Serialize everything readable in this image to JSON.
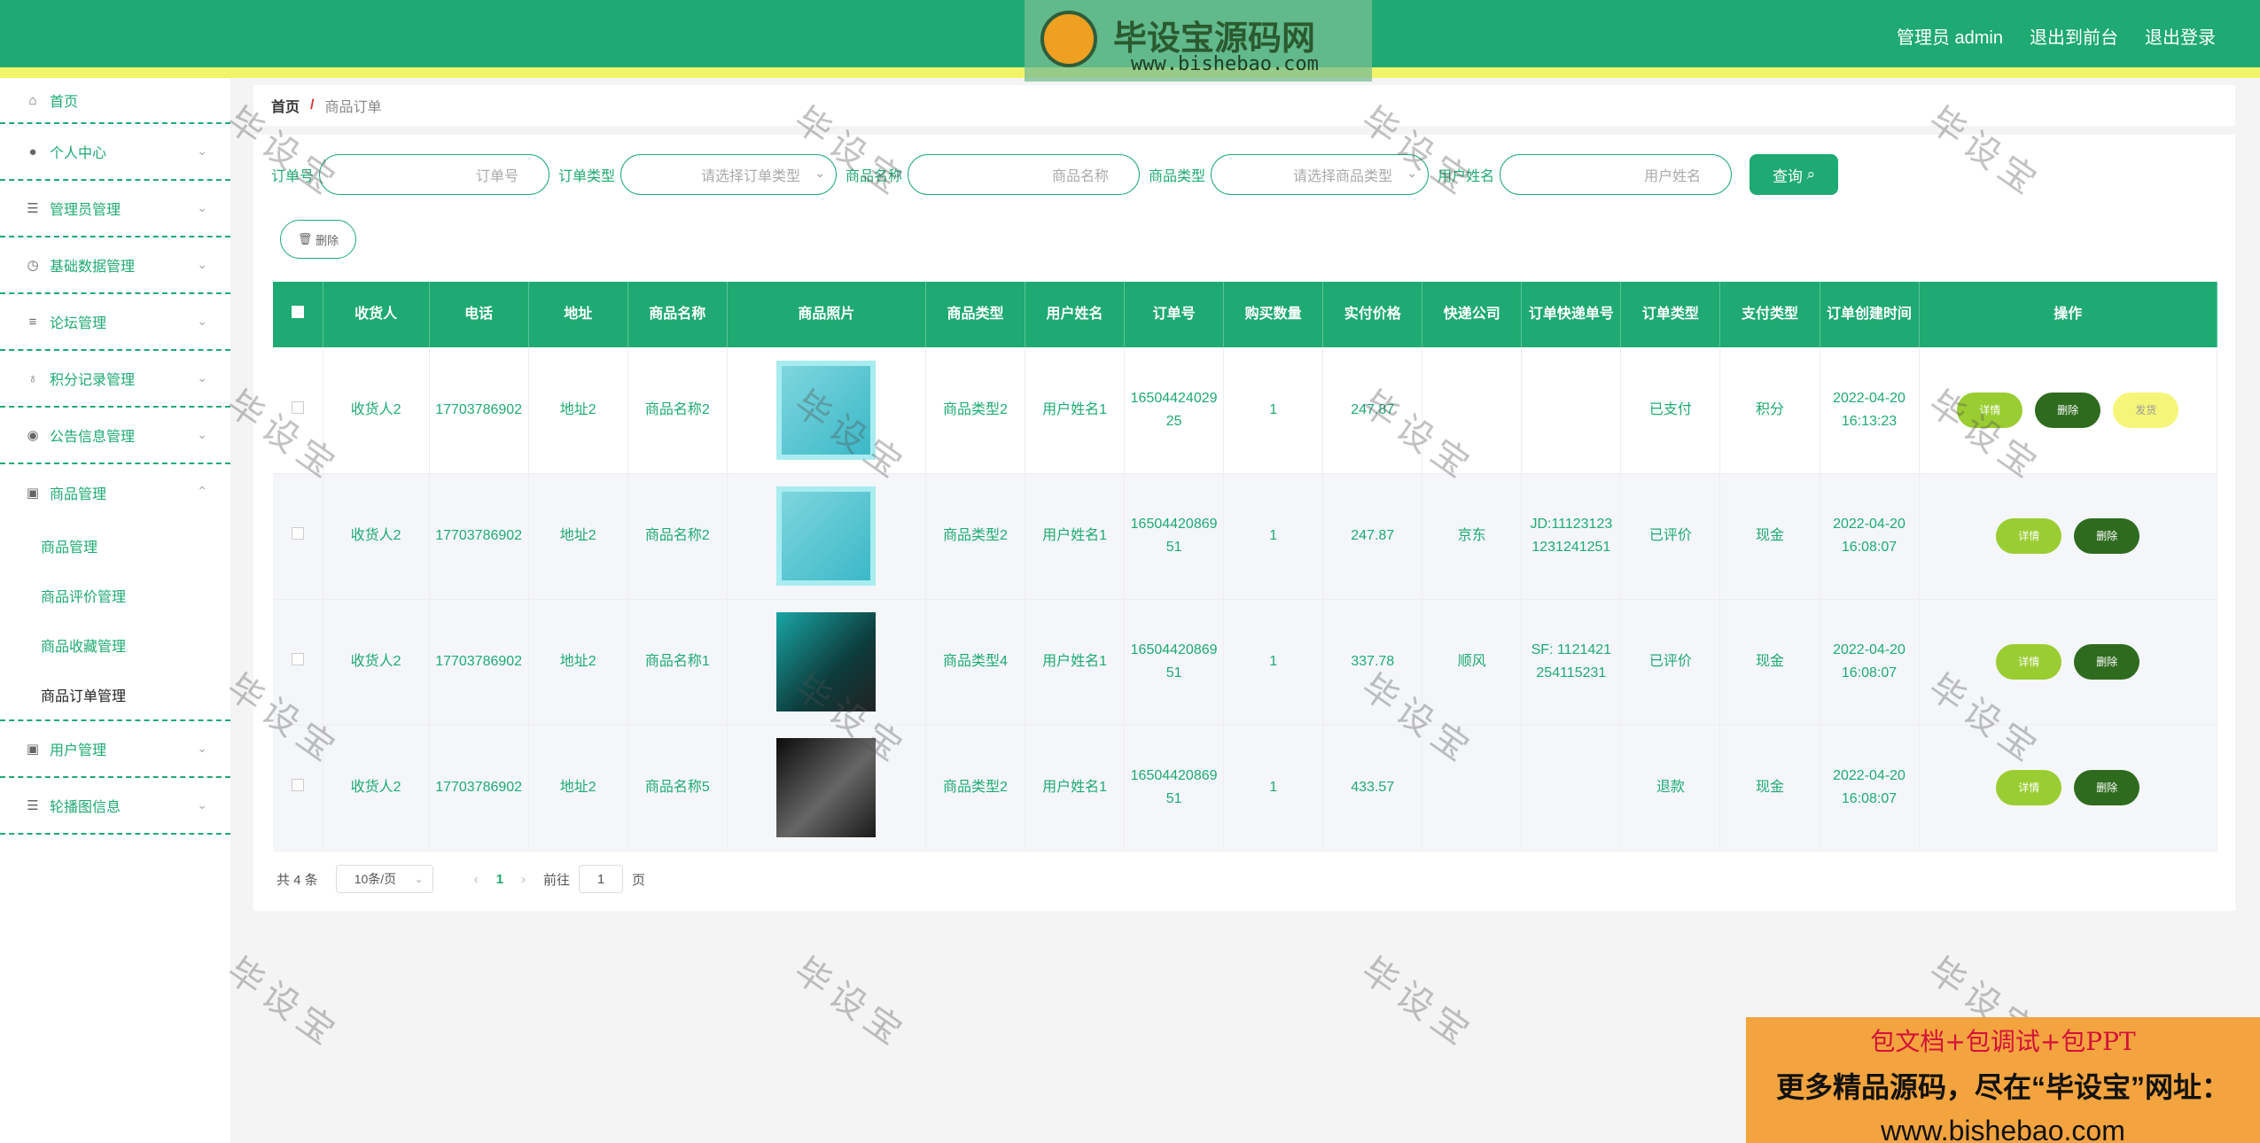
{
  "header": {
    "logo_title": "毕设宝源码网",
    "logo_url": "www.bishebao.com",
    "admin_label": "管理员 admin",
    "to_front": "退出到前台",
    "logout": "退出登录"
  },
  "sidebar": {
    "home": "首页",
    "items": [
      "个人中心",
      "管理员管理",
      "基础数据管理",
      "论坛管理",
      "积分记录管理",
      "公告信息管理",
      "商品管理"
    ],
    "sub_items": [
      "商品管理",
      "商品评价管理",
      "商品收藏管理",
      "商品订单管理"
    ],
    "after": [
      "用户管理",
      "轮播图信息"
    ]
  },
  "breadcrumb": {
    "home": "首页",
    "sep": "/",
    "current": "商品订单"
  },
  "search": {
    "order_no_label": "订单号",
    "order_no_ph": "订单号",
    "order_type_label": "订单类型",
    "order_type_ph": "请选择订单类型",
    "goods_name_label": "商品名称",
    "goods_name_ph": "商品名称",
    "goods_type_label": "商品类型",
    "goods_type_ph": "请选择商品类型",
    "user_label": "用户姓名",
    "user_ph": "用户姓名",
    "query_btn": "查询"
  },
  "delete_btn": "删除",
  "table": {
    "headers": [
      "收货人",
      "电话",
      "地址",
      "商品名称",
      "商品照片",
      "商品类型",
      "用户姓名",
      "订单号",
      "购买数量",
      "实付价格",
      "快递公司",
      "订单快递单号",
      "订单类型",
      "支付类型",
      "订单创建时间",
      "操作"
    ],
    "rows": [
      {
        "receiver": "收货人2",
        "phone": "17703786902",
        "address": "地址2",
        "goods": "商品名称2",
        "goods_type": "商品类型2",
        "user": "用户姓名1",
        "order_no": "1650442402925",
        "qty": "1",
        "price": "247.87",
        "courier": "",
        "tracking": "",
        "order_type": "已支付",
        "pay_type": "积分",
        "created": "2022-04-20 16:13:23",
        "detail": "详情",
        "del": "删除",
        "ship": "发货"
      },
      {
        "receiver": "收货人2",
        "phone": "17703786902",
        "address": "地址2",
        "goods": "商品名称2",
        "goods_type": "商品类型2",
        "user": "用户姓名1",
        "order_no": "1650442086951",
        "qty": "1",
        "price": "247.87",
        "courier": "京东",
        "tracking": "JD:111231231231241251",
        "order_type": "已评价",
        "pay_type": "现金",
        "created": "2022-04-20 16:08:07",
        "detail": "详情",
        "del": "删除"
      },
      {
        "receiver": "收货人2",
        "phone": "17703786902",
        "address": "地址2",
        "goods": "商品名称1",
        "goods_type": "商品类型4",
        "user": "用户姓名1",
        "order_no": "1650442086951",
        "qty": "1",
        "price": "337.78",
        "courier": "顺风",
        "tracking": "SF: 1121421254115231",
        "order_type": "已评价",
        "pay_type": "现金",
        "created": "2022-04-20 16:08:07",
        "detail": "详情",
        "del": "删除"
      },
      {
        "receiver": "收货人2",
        "phone": "17703786902",
        "address": "地址2",
        "goods": "商品名称5",
        "goods_type": "商品类型2",
        "user": "用户姓名1",
        "order_no": "1650442086951",
        "qty": "1",
        "price": "433.57",
        "courier": "",
        "tracking": "",
        "order_type": "退款",
        "pay_type": "现金",
        "created": "2022-04-20 16:08:07",
        "detail": "详情",
        "del": "删除"
      }
    ]
  },
  "pager": {
    "total": "共 4 条",
    "size": "10条/页",
    "current": "1",
    "goto": "前往",
    "goto_val": "1",
    "page": "页"
  },
  "watermark": "毕设宝",
  "ad": {
    "l1": "包文档+包调试+包PPT",
    "l2": "更多精品源码，尽在“毕设宝”网址：",
    "l3": "www.bishebao.com"
  }
}
